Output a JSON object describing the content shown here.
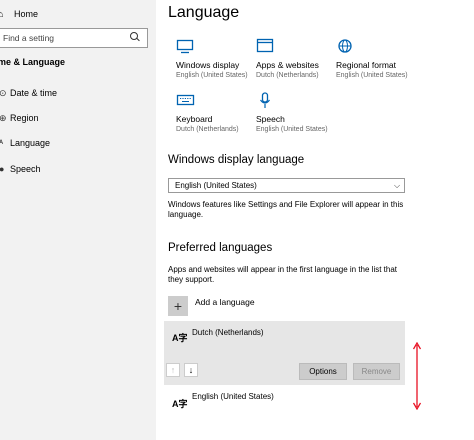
{
  "sidebar": {
    "home": "Home",
    "search_placeholder": "Find a setting",
    "section": "me & Language",
    "items": [
      {
        "label": "Date & time",
        "icon": "clock-icon"
      },
      {
        "label": "Region",
        "icon": "region-icon"
      },
      {
        "label": "Language",
        "icon": "language-icon"
      },
      {
        "label": "Speech",
        "icon": "speech-icon"
      }
    ]
  },
  "page": {
    "title": "Language",
    "tiles": [
      {
        "name": "Windows display",
        "sub": "English (United States)",
        "icon": "monitor-icon"
      },
      {
        "name": "Apps & websites",
        "sub": "Dutch (Netherlands)",
        "icon": "window-icon"
      },
      {
        "name": "Regional format",
        "sub": "English (United States)",
        "icon": "globe-icon"
      },
      {
        "name": "Keyboard",
        "sub": "Dutch (Netherlands)",
        "icon": "keyboard-icon"
      },
      {
        "name": "Speech",
        "sub": "English (United States)",
        "icon": "microphone-icon"
      }
    ],
    "display_heading": "Windows display language",
    "display_value": "English (United States)",
    "display_note": "Windows features like Settings and File Explorer will appear in this language.",
    "preferred_heading": "Preferred languages",
    "preferred_note": "Apps and websites will appear in the first language in the list that they support.",
    "add_label": "Add a language",
    "languages": [
      {
        "name": "Dutch (Netherlands)"
      },
      {
        "name": "English (United States)"
      }
    ],
    "options_label": "Options",
    "remove_label": "Remove",
    "accent_color": "#0063b1",
    "annotation_color": "#e81123"
  }
}
